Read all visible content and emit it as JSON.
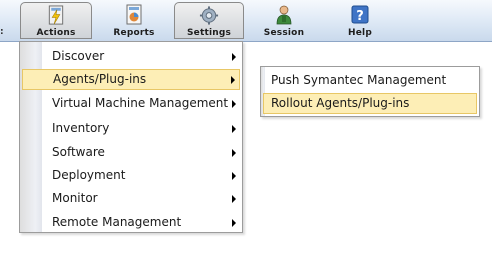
{
  "toolbar": {
    "edge_mark": ":",
    "buttons": [
      {
        "label": "Actions",
        "icon": "actions-icon",
        "pressed": true
      },
      {
        "label": "Reports",
        "icon": "reports-icon",
        "pressed": false
      },
      {
        "label": "Settings",
        "icon": "settings-icon",
        "pressed": true
      },
      {
        "label": "Session",
        "icon": "session-icon",
        "pressed": false
      },
      {
        "label": "Help",
        "icon": "help-icon",
        "pressed": false
      }
    ]
  },
  "menu": {
    "items": [
      {
        "label": "Discover",
        "has_submenu": true
      },
      {
        "label": "Agents/Plug-ins",
        "has_submenu": true,
        "highlighted": true
      },
      {
        "label": "Virtual Machine Management",
        "has_submenu": true
      },
      {
        "label": "Inventory",
        "has_submenu": true
      },
      {
        "label": "Software",
        "has_submenu": true
      },
      {
        "label": "Deployment",
        "has_submenu": true
      },
      {
        "label": "Monitor",
        "has_submenu": true
      },
      {
        "label": "Remote Management",
        "has_submenu": true
      }
    ]
  },
  "submenu": {
    "items": [
      {
        "label": "Push Symantec Management Agent"
      },
      {
        "label": "Rollout Agents/Plug-ins",
        "highlighted": true
      }
    ]
  },
  "colors": {
    "highlight_fill": "#fdeeb6",
    "highlight_border": "#e8c766",
    "toolbar_top": "#f6f9fd",
    "toolbar_bottom": "#c9d9ec"
  }
}
